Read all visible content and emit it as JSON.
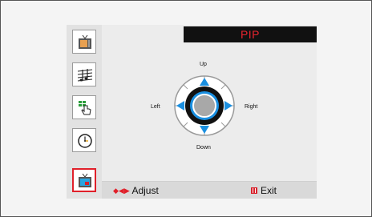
{
  "menu": {
    "title": "PIP"
  },
  "sidebar": {
    "items": [
      {
        "icon": "picture-icon"
      },
      {
        "icon": "sound-icon"
      },
      {
        "icon": "channel-icon"
      },
      {
        "icon": "setup-icon"
      },
      {
        "icon": "pip-icon",
        "selected": true
      }
    ]
  },
  "position_control": {
    "up_label": "Up",
    "down_label": "Down",
    "left_label": "Left",
    "right_label": "Right"
  },
  "footer": {
    "adjust_glyph": "◆◀▶",
    "adjust_label": "Adjust",
    "exit_label": "Exit"
  },
  "colors": {
    "accent_red": "#e0202a",
    "arrow_blue": "#1a8fe0",
    "title_bg": "#111111"
  }
}
